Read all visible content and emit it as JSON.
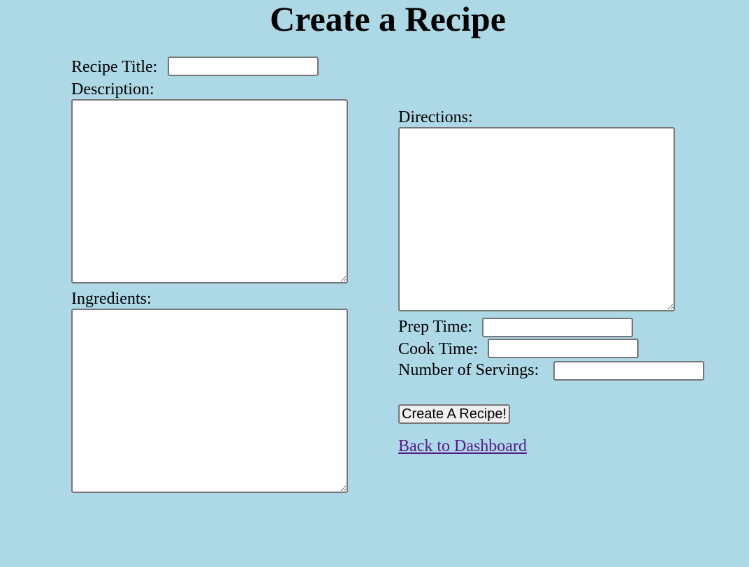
{
  "page": {
    "title": "Create a Recipe"
  },
  "form": {
    "recipe_title_label": "Recipe Title:",
    "recipe_title_value": "",
    "description_label": "Description:",
    "description_value": "",
    "ingredients_label": "Ingredients:",
    "ingredients_value": "",
    "directions_label": "Directions:",
    "directions_value": "",
    "prep_time_label": "Prep Time:",
    "prep_time_value": "",
    "cook_time_label": "Cook Time:",
    "cook_time_value": "",
    "servings_label": "Number of Servings:",
    "servings_value": "",
    "submit_label": "Create A Recipe!"
  },
  "links": {
    "back_to_dashboard": "Back to Dashboard"
  },
  "colors": {
    "background": "#add8e6",
    "visited_link": "#551a8b"
  }
}
